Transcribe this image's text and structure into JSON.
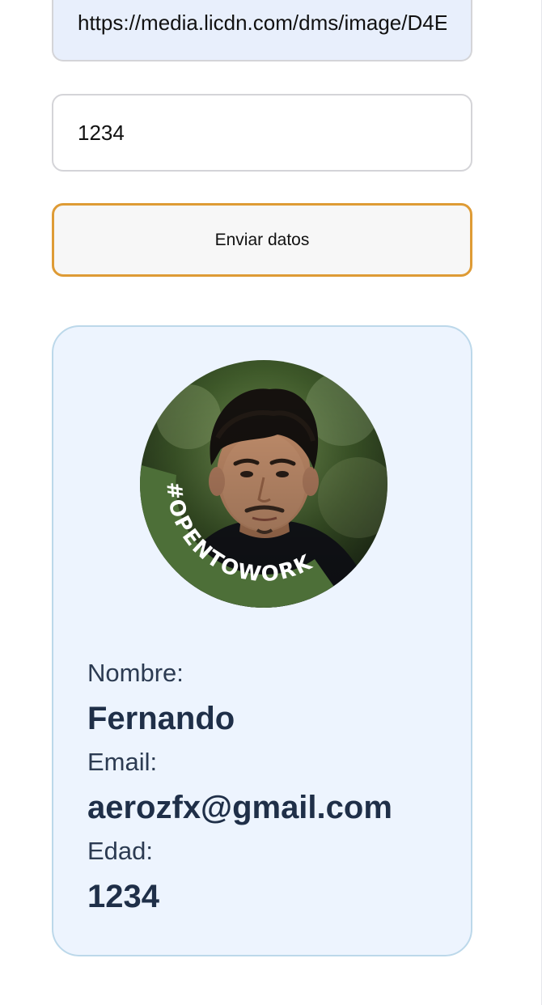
{
  "form": {
    "image_url_value": "https://media.licdn.com/dms/image/D4E",
    "age_value": "1234",
    "submit_label": "Enviar datos"
  },
  "profile": {
    "badge_text": "#OPENTOWORK",
    "name_label": "Nombre:",
    "name_value": "Fernando",
    "email_label": "Email:",
    "email_value": "aerozfx@gmail.com",
    "age_label": "Edad:",
    "age_value": "1234"
  },
  "colors": {
    "accent_border": "#de9b35",
    "card_background": "#edf4fe",
    "card_border": "#bcd8ea",
    "badge_green": "#4d6f38",
    "text_dark": "#1f2f48"
  }
}
